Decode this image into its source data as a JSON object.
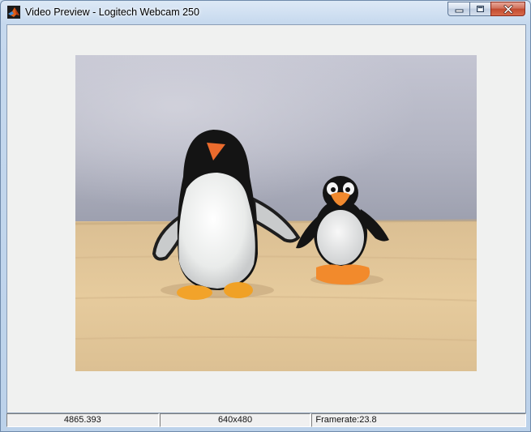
{
  "window": {
    "title": "Video Preview - Logitech Webcam 250",
    "controls": {
      "minimize": "minimize-icon",
      "maximize": "maximize-icon",
      "close": "close-icon"
    },
    "app_icon": "matlab-icon"
  },
  "status_bar": {
    "timestamp": "4865.393",
    "resolution": "640x480",
    "framerate": "Framerate:23.8"
  },
  "colors": {
    "close_button": "#c9503a",
    "client_background": "#f0f1f0"
  }
}
